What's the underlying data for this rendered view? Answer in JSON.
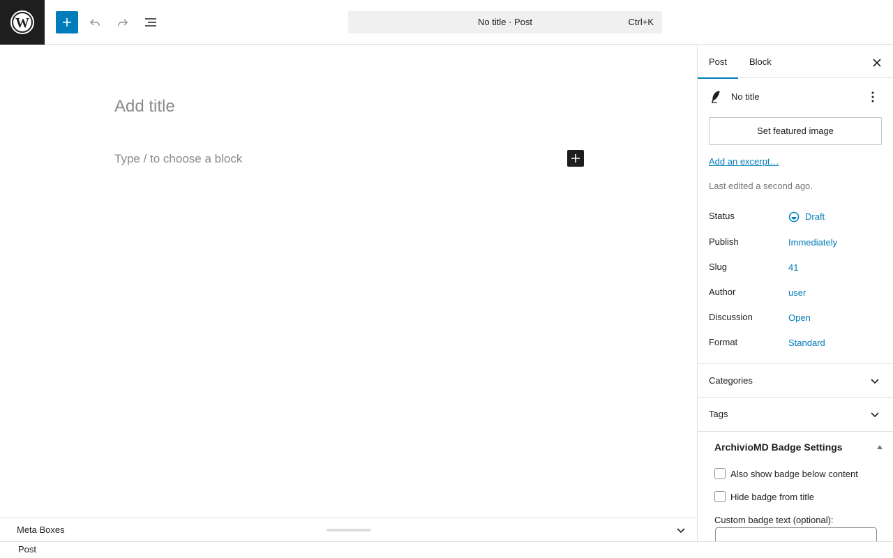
{
  "header": {
    "command_title": "No title · Post",
    "command_shortcut": "Ctrl+K"
  },
  "editor": {
    "title_placeholder": "Add title",
    "block_placeholder": "Type / to choose a block"
  },
  "metabox": {
    "label": "Meta Boxes"
  },
  "footer": {
    "breadcrumb": "Post"
  },
  "sidebar": {
    "tabs": [
      {
        "label": "Post",
        "active": true
      },
      {
        "label": "Block",
        "active": false
      }
    ],
    "post_title": "No title",
    "featured_image_label": "Set featured image",
    "excerpt_link": "Add an excerpt…",
    "last_edited": "Last edited a second ago.",
    "properties": [
      {
        "label": "Status",
        "value": "Draft"
      },
      {
        "label": "Publish",
        "value": "Immediately"
      },
      {
        "label": "Slug",
        "value": "41"
      },
      {
        "label": "Author",
        "value": "user"
      },
      {
        "label": "Discussion",
        "value": "Open"
      },
      {
        "label": "Format",
        "value": "Standard"
      }
    ],
    "panels": [
      {
        "label": "Categories"
      },
      {
        "label": "Tags"
      }
    ],
    "archivio": {
      "title": "ArchivioMD Badge Settings",
      "options": [
        {
          "label": "Also show badge below content",
          "checked": false
        },
        {
          "label": "Hide badge from title",
          "checked": false
        }
      ],
      "custom_text_label": "Custom badge text (optional):",
      "custom_text_value": ""
    }
  },
  "colors": {
    "accent": "#007cba",
    "dark": "#1e1e1e",
    "border": "#e0e0e0",
    "placeholder": "#8a8a8a"
  }
}
